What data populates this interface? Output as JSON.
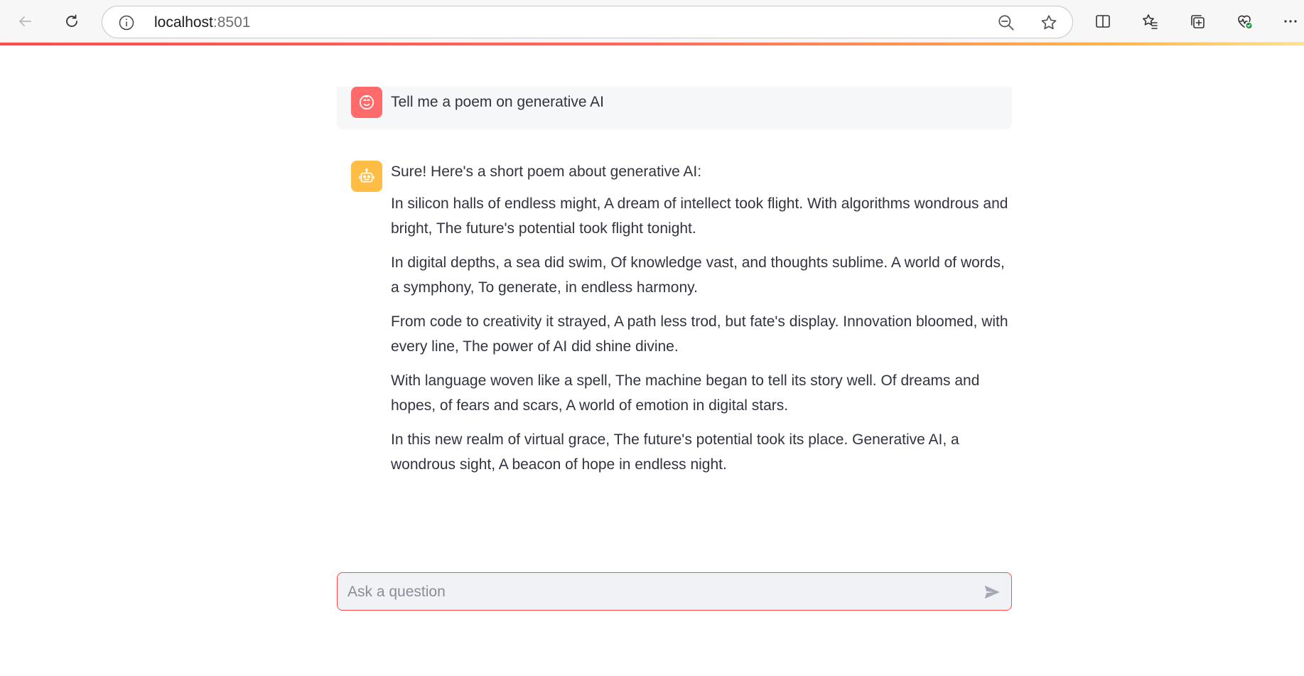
{
  "browser": {
    "url_host": "localhost",
    "url_port": ":8501",
    "icons": [
      "back-arrow-icon",
      "refresh-icon",
      "info-icon",
      "zoom-out-icon",
      "favorite-star-icon",
      "split-screen-icon",
      "favorites-list-icon",
      "collections-icon",
      "browser-essentials-icon",
      "more-options-icon"
    ]
  },
  "chat": {
    "user_message": "Tell me a poem on generative AI",
    "assistant_intro": "Sure! Here's a short poem about generative AI:",
    "assistant_stanzas": [
      "In silicon halls of endless might, A dream of intellect took flight. With algorithms wondrous and bright, The future's potential took flight tonight.",
      "In digital depths, a sea did swim, Of knowledge vast, and thoughts sublime. A world of words, a symphony, To generate, in endless harmony.",
      "From code to creativity it strayed, A path less trod, but fate's display. Innovation bloomed, with every line, The power of AI did shine divine.",
      "With language woven like a spell, The machine began to tell its story well. Of dreams and hopes, of fears and scars, A world of emotion in digital stars.",
      "In this new realm of virtual grace, The future's potential took its place. Generative AI, a wondrous sight, A beacon of hope in endless night."
    ],
    "input_placeholder": "Ask a question",
    "input_value": ""
  },
  "colors": {
    "user_avatar": "#ff6b6b",
    "bot_avatar": "#ffbd45",
    "input_border": "#ff4b4b",
    "input_bg": "#f0f2f6"
  }
}
